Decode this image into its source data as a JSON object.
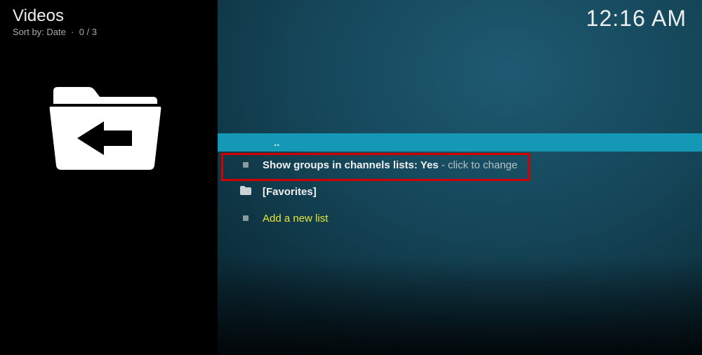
{
  "header": {
    "title": "Videos",
    "sort_label": "Sort by: Date",
    "count": "0 / 3",
    "clock": "12:16 AM"
  },
  "list": {
    "parent": "..",
    "item_showgroups_prefix": "Show groups in channels lists: ",
    "item_showgroups_value": "Yes",
    "item_showgroups_suffix": " - click to change",
    "item_favorites": "[Favorites]",
    "item_addnew": "Add a new list"
  }
}
